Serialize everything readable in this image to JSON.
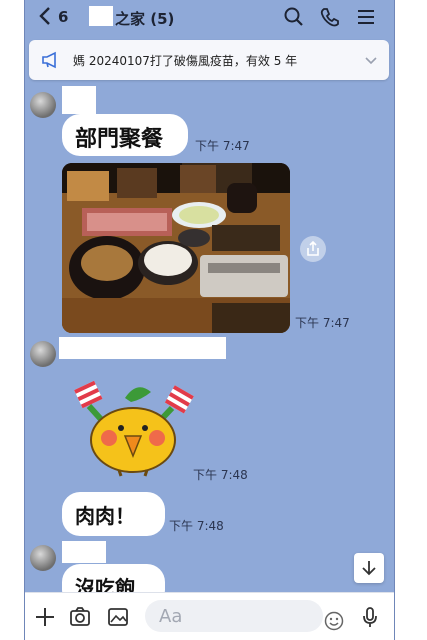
{
  "header": {
    "member_count": "6",
    "chat_title": "之家 (5)"
  },
  "notice": {
    "text": "媽 20240107打了破傷風疫苗，有效 5 年"
  },
  "messages": {
    "m1_text": "部門聚餐",
    "m1_time": "下午 7:47",
    "m2_time": "下午 7:47",
    "m3_time": "下午 7:48",
    "m4_text": "肉肉！",
    "m4_time": "下午 7:48",
    "m5_text": "沒吃飽"
  },
  "composer": {
    "placeholder": "Aa"
  },
  "colors": {
    "chat_background": "#8fa9d8",
    "bubble": "#ffffff"
  }
}
